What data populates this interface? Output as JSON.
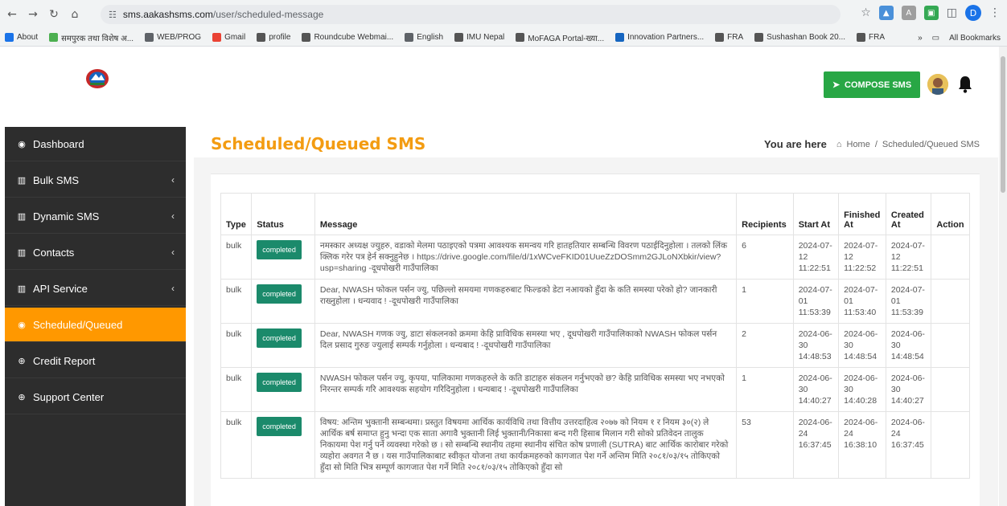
{
  "browser": {
    "url_host": "sms.aakashsms.com",
    "url_path": "/user/scheduled-message",
    "bookmarks": [
      {
        "label": "About",
        "color": "#1a73e8"
      },
      {
        "label": "समपुरक तथा विशेष अ...",
        "color": "#4caf50"
      },
      {
        "label": "WEB/PROG",
        "color": "#5f6368"
      },
      {
        "label": "Gmail",
        "color": "#ea4335"
      },
      {
        "label": "profile",
        "color": "#555555"
      },
      {
        "label": "Roundcube Webmai...",
        "color": "#555555"
      },
      {
        "label": "English",
        "color": "#5f6368"
      },
      {
        "label": "IMU Nepal",
        "color": "#555555"
      },
      {
        "label": "MoFAGA Portal-ख्या...",
        "color": "#555555"
      },
      {
        "label": "Innovation Partners...",
        "color": "#1565c0"
      },
      {
        "label": "FRA",
        "color": "#555555"
      },
      {
        "label": "Sushashan Book 20...",
        "color": "#555555"
      },
      {
        "label": "FRA",
        "color": "#555555"
      }
    ],
    "more": "»",
    "all_bookmarks": "All Bookmarks",
    "profile_initial": "D"
  },
  "header": {
    "compose_label": "COMPOSE SMS"
  },
  "sidebar": {
    "items": [
      {
        "label": "Dashboard",
        "icon": "dashboard-icon",
        "caret": false,
        "active": false
      },
      {
        "label": "Bulk SMS",
        "icon": "bar-chart-icon",
        "caret": true,
        "active": false
      },
      {
        "label": "Dynamic SMS",
        "icon": "bar-chart-icon",
        "caret": true,
        "active": false
      },
      {
        "label": "Contacts",
        "icon": "bar-chart-icon",
        "caret": true,
        "active": false
      },
      {
        "label": "API Service",
        "icon": "bar-chart-icon",
        "caret": true,
        "active": false
      },
      {
        "label": "Scheduled/Queued",
        "icon": "dashboard-icon",
        "caret": false,
        "active": true
      },
      {
        "label": "Credit Report",
        "icon": "support-icon",
        "caret": false,
        "active": false
      },
      {
        "label": "Support Center",
        "icon": "support-icon",
        "caret": false,
        "active": false
      }
    ]
  },
  "main": {
    "title": "Scheduled/Queued SMS",
    "breadcrumb": {
      "you_are_here": "You are here",
      "home": "Home",
      "separator": "/",
      "current": "Scheduled/Queued SMS"
    },
    "table": {
      "headers": [
        "Type",
        "Status",
        "Message",
        "Recipients",
        "Start At",
        "Finished At",
        "Created At",
        "Action"
      ],
      "rows": [
        {
          "type": "bulk",
          "status": "completed",
          "message": "नमस्कार अध्यक्ष ज्युहरु, वडाको मेलमा पठाइएको पत्रमा आवश्यक समन्वय गरि हातहतियार सम्बन्धि विवरण पठाईदिनुहोला । तलको लिंक क्लिक गरेर पत्र हेर्न सक्नुहुनेछ । https://drive.google.com/file/d/1xWCveFKID01UueZzDOSmm2GJLoNXbkir/view?usp=sharing -दूधपोखरी गाउँपालिका",
          "recipients": "6",
          "start_at": "2024-07-12 11:22:51",
          "finished_at": "2024-07-12 11:22:52",
          "created_at": "2024-07-12 11:22:51"
        },
        {
          "type": "bulk",
          "status": "completed",
          "message": "Dear, NWASH फोकल पर्सन ज्यु, पछिल्लो समयमा गणकहरुबाट फिल्डको डेटा नआयको हुँदा के कति समस्या परेको हो? जानकारी राख्नुहोला । धन्यवाद ! -दूधपोखरी गाउँपालिका",
          "recipients": "1",
          "start_at": "2024-07-01 11:53:39",
          "finished_at": "2024-07-01 11:53:40",
          "created_at": "2024-07-01 11:53:39"
        },
        {
          "type": "bulk",
          "status": "completed",
          "message": "Dear, NWASH गणक ज्यु, डाटा संकलनको क्रममा केहि प्राविधिक समस्या भए , दूधपोखरी गाउँपालिकाको NWASH फोकल पर्सन दिल प्रसाद गुरुङ ज्युलाई सम्पर्क गर्नुहोला । धन्यबाद ! -दूधपोखरी गाउँपालिका",
          "recipients": "2",
          "start_at": "2024-06-30 14:48:53",
          "finished_at": "2024-06-30 14:48:54",
          "created_at": "2024-06-30 14:48:54"
        },
        {
          "type": "bulk",
          "status": "completed",
          "message": "NWASH फोकल पर्सन ज्यु, कृपया, पालिकामा गणकहरुले के कति डाटाहरु संकलन गर्नुभएको छ? केहि प्राविधिक समस्या भए नभएको निरन्तर सम्पर्क गरि आवश्यक सहयोग गरिदिनुहोला । धन्यबाद ! -दूधपोखरी गाउँपालिका",
          "recipients": "1",
          "start_at": "2024-06-30 14:40:27",
          "finished_at": "2024-06-30 14:40:28",
          "created_at": "2024-06-30 14:40:27"
        },
        {
          "type": "bulk",
          "status": "completed",
          "message": "विषय: अन्तिम भुक्तानी सम्बन्धमा। प्रस्तुत विषयमा आर्थिक कार्यविधि तथा वित्तीय उत्तरदाहित्व २०७७ को नियम १ र नियम ३०(२) ले आर्थिक बर्ष समाप्त हुनु भन्दा एक साता अगावै भुक्तानी लिई भुक्तानी/निकासा बन्द गरी हिसाब मिलान गरी सोको प्रतिवेदन तालुक निकायमा पेश गर्नु पर्ने व्यवस्था गरेको छ । सो सम्बन्धि स्थानीय तहमा स्थानीय संचित कोष प्रणाली (SUTRA) बाट आर्थिक कारोबार गरेको व्यहोरा अवगत नै छ । यस गाउँपालिकाबाट स्वीकृत योजना तथा कार्यक्रमहरुको कागजात पेश गर्ने अन्तिम मिति २०८१/०३/१५ तोकिएको हुँदा सो मिति भित्र सम्पूर्ण कागजात पेश गर्ने मिति २०८१/०३/१५ तोकिएको हुँदा सो",
          "recipients": "53",
          "start_at": "2024-06-24 16:37:45",
          "finished_at": "2024-06-24 16:38:10",
          "created_at": "2024-06-24 16:37:45"
        }
      ]
    }
  },
  "colors": {
    "accent_orange": "#f39c12",
    "sidebar_bg": "#2d2d2d",
    "active_item": "#ff9800",
    "compose_green": "#28a745",
    "badge_green": "#1b8a6b"
  }
}
